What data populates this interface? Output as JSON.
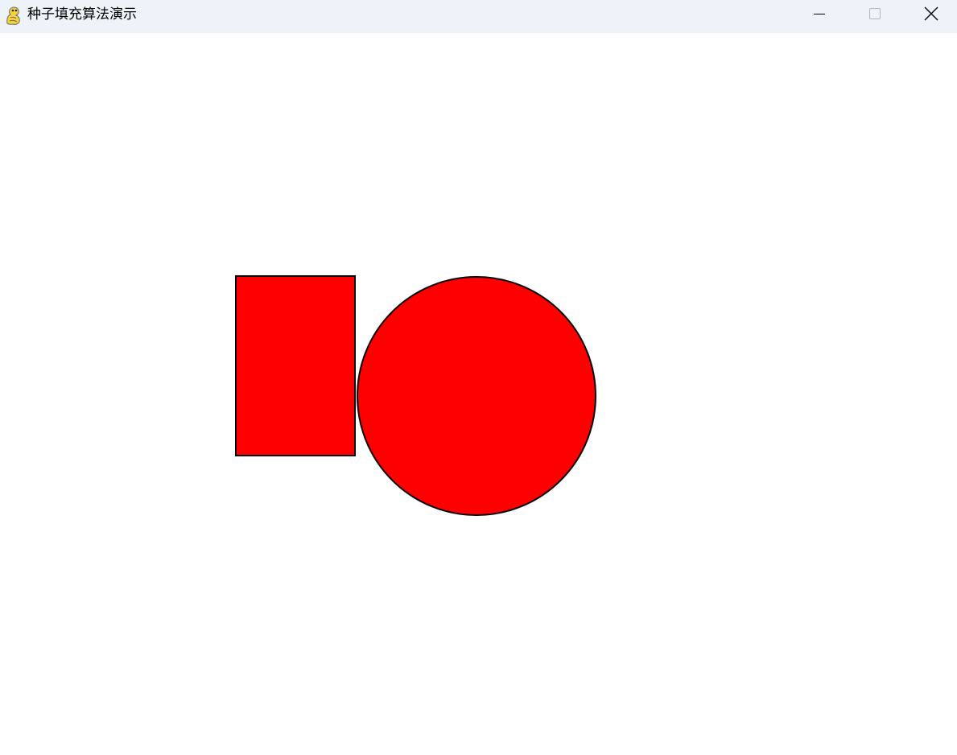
{
  "window": {
    "title": "种子填充算法演示",
    "app_icon": "pygame-snake-icon",
    "controls": {
      "minimize_icon": "minimize-icon",
      "maximize_icon": "maximize-icon",
      "close_icon": "close-icon"
    }
  },
  "canvas": {
    "background_color": "#ffffff",
    "shapes": [
      {
        "kind": "rectangle",
        "fill": "#ff0000",
        "stroke": "#000000"
      },
      {
        "kind": "circle",
        "fill": "#ff0000",
        "stroke": "#000000"
      }
    ]
  },
  "colors": {
    "titlebar_bg": "#edf3f8",
    "fill": "#ff0000",
    "outline": "#000000"
  }
}
